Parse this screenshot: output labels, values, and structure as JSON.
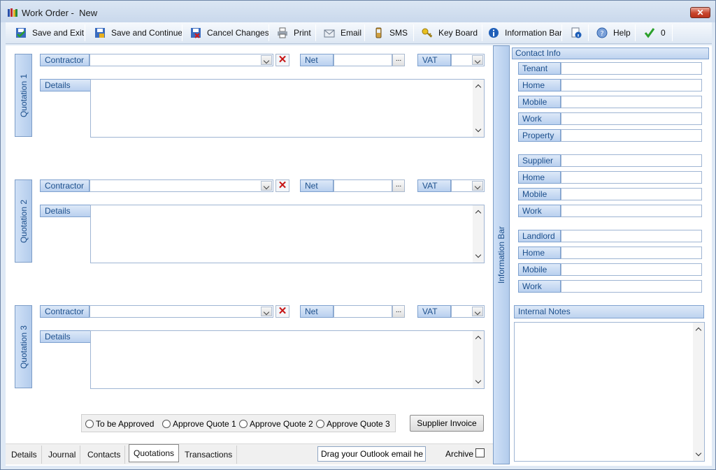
{
  "window": {
    "title": "Work Order -  New",
    "close_label": "✕"
  },
  "toolbar": {
    "save_exit": "Save and Exit",
    "save_continue": "Save and Continue",
    "cancel": "Cancel Changes",
    "print": "Print",
    "email": "Email",
    "sms": "SMS",
    "keyboard": "Key Board",
    "infobar": "Information Bar",
    "help": "Help",
    "tick_count": "0"
  },
  "quotations": [
    {
      "tab": "Quotation 1",
      "contractor_label": "Contractor",
      "net_label": "Net",
      "vat_label": "VAT",
      "details_label": "Details",
      "ellipsis": "..."
    },
    {
      "tab": "Quotation 2",
      "contractor_label": "Contractor",
      "net_label": "Net",
      "vat_label": "VAT",
      "details_label": "Details",
      "ellipsis": "..."
    },
    {
      "tab": "Quotation 3",
      "contractor_label": "Contractor",
      "net_label": "Net",
      "vat_label": "VAT",
      "details_label": "Details",
      "ellipsis": "..."
    }
  ],
  "approval": {
    "options": [
      "To be Approved",
      "Approve Quote 1",
      "Approve Quote 2",
      "Approve Quote 3"
    ],
    "supplier_invoice": "Supplier Invoice"
  },
  "tabs": [
    "Details",
    "Journal",
    "Contacts",
    "Quotations",
    "Transactions"
  ],
  "active_tab": "Quotations",
  "drag_placeholder": "Drag your Outlook email he",
  "archive_label": "Archive",
  "information_bar": "Information Bar",
  "contact_info": {
    "header": "Contact Info",
    "tenant": [
      "Tenant",
      "Home",
      "Mobile",
      "Work",
      "Property"
    ],
    "supplier": [
      "Supplier",
      "Home",
      "Mobile",
      "Work"
    ],
    "landlord": [
      "Landlord",
      "Home",
      "Mobile",
      "Work"
    ]
  },
  "internal_notes": "Internal Notes"
}
